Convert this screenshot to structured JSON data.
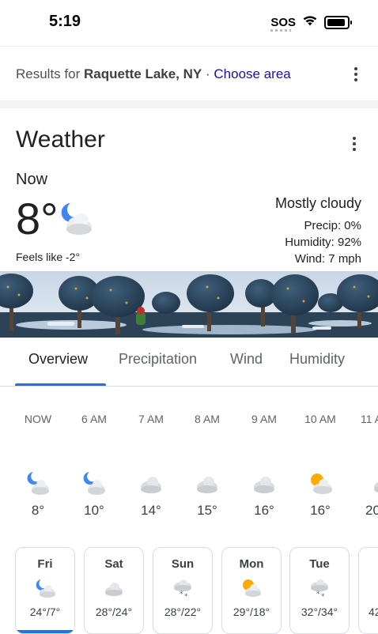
{
  "status_bar": {
    "time": "5:19",
    "sos": "SOS"
  },
  "results": {
    "prefix": "Results for",
    "location": "Raquette Lake, NY",
    "separator": "·",
    "choose_area": "Choose area"
  },
  "weather": {
    "title": "Weather",
    "now_label": "Now",
    "temperature": "8°",
    "feels_like": "Feels like -2°",
    "condition": "Mostly cloudy",
    "precip": "Precip: 0%",
    "humidity": "Humidity: 92%",
    "wind": "Wind: 7 mph"
  },
  "tabs": [
    "Overview",
    "Precipitation",
    "Wind",
    "Humidity"
  ],
  "active_tab": "Overview",
  "hourly": [
    {
      "time": "NOW",
      "temp": "8°",
      "icon": "moon-cloud-icon"
    },
    {
      "time": "6 AM",
      "temp": "10°",
      "icon": "moon-cloud-icon"
    },
    {
      "time": "7 AM",
      "temp": "14°",
      "icon": "cloud-icon"
    },
    {
      "time": "8 AM",
      "temp": "15°",
      "icon": "cloud-icon"
    },
    {
      "time": "9 AM",
      "temp": "16°",
      "icon": "cloud-icon"
    },
    {
      "time": "10 AM",
      "temp": "16°",
      "icon": "sun-cloud-icon"
    },
    {
      "time": "11 A",
      "temp": "20",
      "icon": "cloud-icon"
    }
  ],
  "daily": [
    {
      "day": "Fri",
      "temps": "24°/7°",
      "icon": "moon-cloud-icon",
      "selected": true
    },
    {
      "day": "Sat",
      "temps": "28°/24°",
      "icon": "cloud-icon"
    },
    {
      "day": "Sun",
      "temps": "28°/22°",
      "icon": "snow-cloud-icon"
    },
    {
      "day": "Mon",
      "temps": "29°/18°",
      "icon": "sun-cloud-icon"
    },
    {
      "day": "Tue",
      "temps": "32°/34°",
      "icon": "snow-cloud-icon"
    },
    {
      "day": "",
      "temps": "42",
      "icon": ""
    }
  ],
  "colors": {
    "accent": "#1a73e8",
    "link": "#1a0dab",
    "moon": "#4285f4",
    "sun": "#f9ab00"
  }
}
